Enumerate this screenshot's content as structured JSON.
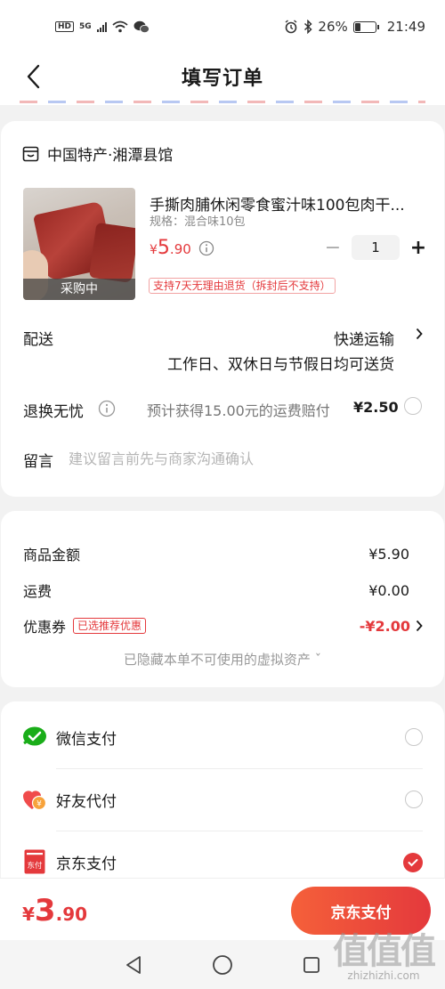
{
  "status_bar": {
    "hd": "HD",
    "network": "5G",
    "battery": "26%",
    "time": "21:49",
    "icons": [
      "wifi-icon",
      "wechat-icon",
      "alarm-icon",
      "bluetooth-icon",
      "battery-icon"
    ]
  },
  "header": {
    "title": "填写订单",
    "back_icon": "chevron-left-icon"
  },
  "shop": {
    "name": "中国特产·湘潭县馆",
    "icon": "store-icon"
  },
  "product": {
    "name": "手撕肉脯休闲零食蜜汁味100包肉干...",
    "spec": "规格：混合味10包",
    "price_yen": "¥",
    "price_int": "5",
    "price_dec": ".90",
    "quantity": "1",
    "minus": "−",
    "plus": "+",
    "image_tag": "采购中",
    "return_policy": "支持7天无理由退货（拆封后不支持）"
  },
  "delivery": {
    "label": "配送",
    "method": "快递运输",
    "detail": "工作日、双休日与节假日均可送货"
  },
  "exchange": {
    "label": "退换无忧",
    "text": "预计获得15.00元的运费赔付",
    "price": "¥2.50"
  },
  "note": {
    "label": "留言",
    "placeholder": "建议留言前先与商家沟通确认"
  },
  "amounts": {
    "goods_label": "商品金额",
    "goods_value": "¥5.90",
    "shipping_label": "运费",
    "shipping_value": "¥0.00",
    "coupon_label": "优惠券",
    "coupon_badge": "已选推荐优惠",
    "coupon_value": "-¥2.00",
    "hidden_assets": "已隐藏本单不可使用的虚拟资产 ˇ"
  },
  "payment": {
    "options": [
      {
        "label": "微信支付",
        "icon": "wechat-pay-icon",
        "selected": false
      },
      {
        "label": "好友代付",
        "icon": "friend-pay-icon",
        "selected": false
      },
      {
        "label": "京东支付",
        "icon": "jd-pay-icon",
        "selected": true
      }
    ],
    "jd_icon_text": "东付"
  },
  "footer": {
    "total_yen": "¥",
    "total_int": "3",
    "total_dec": ".90",
    "pay_button": "京东支付"
  },
  "watermark": {
    "big": "值值值",
    "small": "zhizhizhi.com"
  },
  "colors": {
    "accent": "#e4393c",
    "background": "#f2f2f2",
    "wechat": "#1aad19"
  }
}
